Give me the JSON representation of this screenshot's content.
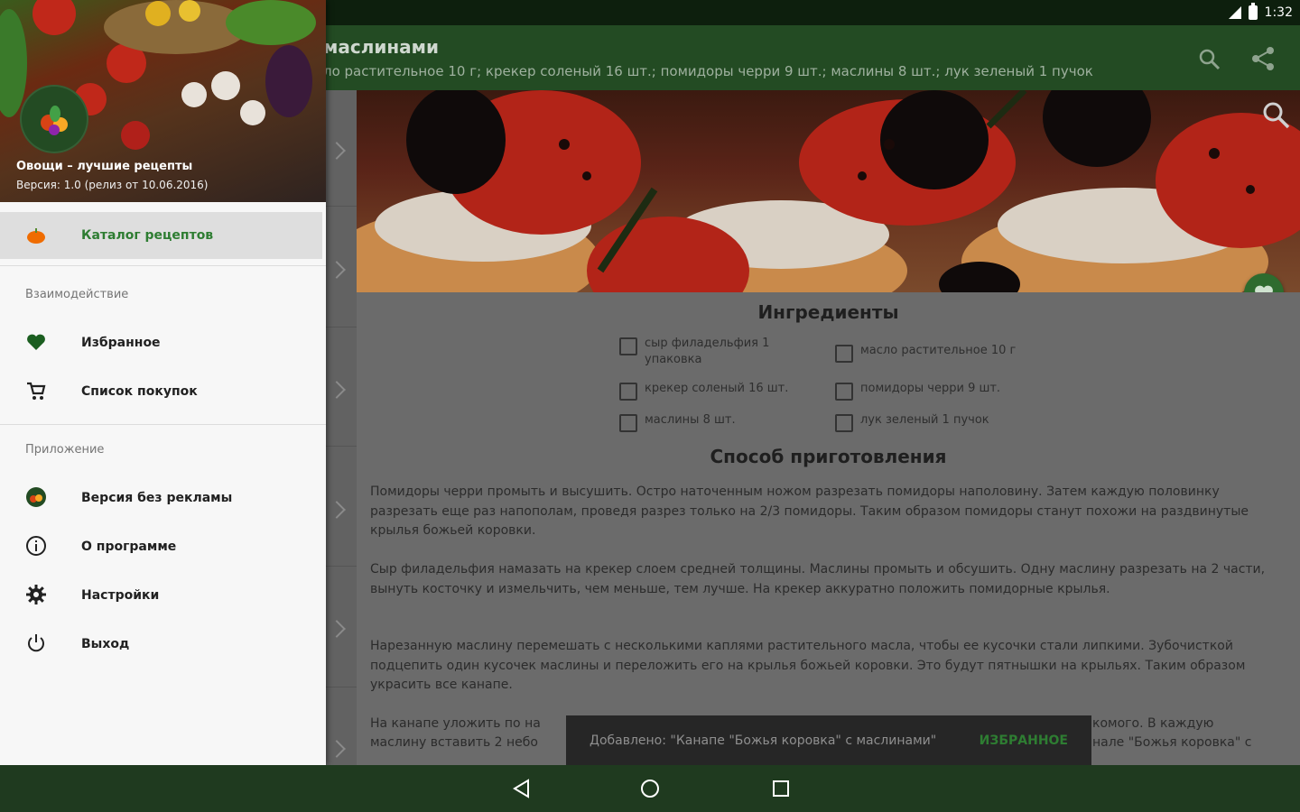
{
  "status_bar": {
    "time": "1:32"
  },
  "app_bar": {
    "title": "маслинами",
    "subtitle": "ло растительное 10 г; крекер соленый 16 шт.; помидоры черри 9 шт.; маслины 8 шт.; лук зеленый 1 пучок"
  },
  "recipe": {
    "ingredients_heading": "Ингредиенты",
    "ingredients": [
      "сыр филадельфия 1 упаковка",
      "масло растительное 10 г",
      "крекер соленый 16 шт.",
      "помидоры черри 9 шт.",
      "маслины 8 шт.",
      "лук зеленый 1 пучок"
    ],
    "method_heading": "Способ приготовления",
    "paragraphs": [
      "Помидоры черри промыть и высушить. Остро наточенным ножом разрезать помидоры наполовину. Затем каждую половинку разрезать еще раз напополам, проведя разрез только на 2/3 помидоры. Таким образом помидоры станут похожи на раздвинутые крылья божьей коровки.",
      "Сыр филадельфия намазать на крекер слоем средней толщины. Маслины промыть и обсушить. Одну маслину разрезать на 2 части, вынуть косточку и измельчить, чем меньше, тем лучше. На крекер аккуратно положить помидорные крылья.",
      "Нарезанную маслину перемешать с несколькими каплями растительного масла, чтобы ее кусочки стали липкими. Зубочисткой подцепить один кусочек маслины и переложить его на крылья божьей коровки. Это будут пятнышки на крыльях. Таким образом украсить все канапе.",
      "На канапе уложить по на",
      "маслину вставить 2 небо",
      "комого. В каждую",
      "нале \"Божья коровка\" с"
    ]
  },
  "snackbar": {
    "message": "Добавлено: \"Канапе \"Божья коровка\" с маслинами\"",
    "action": "ИЗБРАННОЕ"
  },
  "drawer": {
    "header": {
      "title": "Овощи – лучшие рецепты",
      "version": "Версия: 1.0 (релиз от 10.06.2016)"
    },
    "selected_item": "Каталог рецептов",
    "sections": [
      {
        "label": "Взаимодействие",
        "items": [
          "Избранное",
          "Список покупок"
        ]
      },
      {
        "label": "Приложение",
        "items": [
          "Версия без рекламы",
          "О программе",
          "Настройки",
          "Выход"
        ]
      }
    ]
  },
  "colors": {
    "primary": "#234b23",
    "accent": "#2e7d32",
    "drawer_bg": "#f7f7f7"
  }
}
